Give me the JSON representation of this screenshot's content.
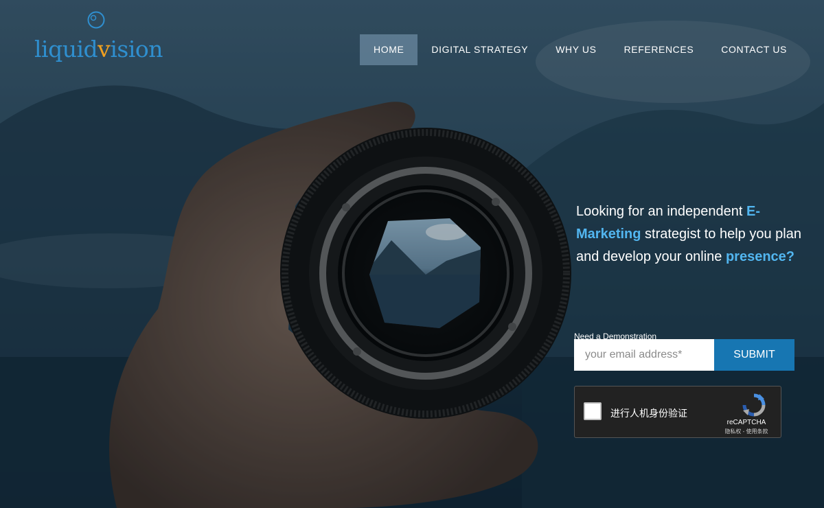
{
  "brand": {
    "logo_prefix": "liquid",
    "logo_accent": "v",
    "logo_suffix": "ision",
    "logo_color": "#2f8fcf",
    "logo_accent_color": "#f0a020"
  },
  "nav": {
    "items": [
      {
        "label": "HOME",
        "active": true
      },
      {
        "label": "DIGITAL STRATEGY"
      },
      {
        "label": "WHY US"
      },
      {
        "label": "REFERENCES"
      },
      {
        "label": "CONTACT US"
      }
    ]
  },
  "hero": {
    "headline_part1": "Looking for an independent ",
    "headline_hl1": "E-Marketing",
    "headline_part2": " strategist to help you plan and develop your online ",
    "headline_hl2": "presence?",
    "highlight_color": "#52b6f0",
    "background_image": "hand holding camera lens showing lake and mountains"
  },
  "form": {
    "label": "Need a Demonstration",
    "email_placeholder": "your email address*",
    "email_value": "",
    "submit_label": "SUBMIT",
    "submit_color": "#1776b2"
  },
  "captcha": {
    "checkbox_label": "进行人机身份验证",
    "brand": "reCAPTCHA",
    "links": "隐私权 - 使用条款",
    "icon": "recaptcha-icon"
  }
}
